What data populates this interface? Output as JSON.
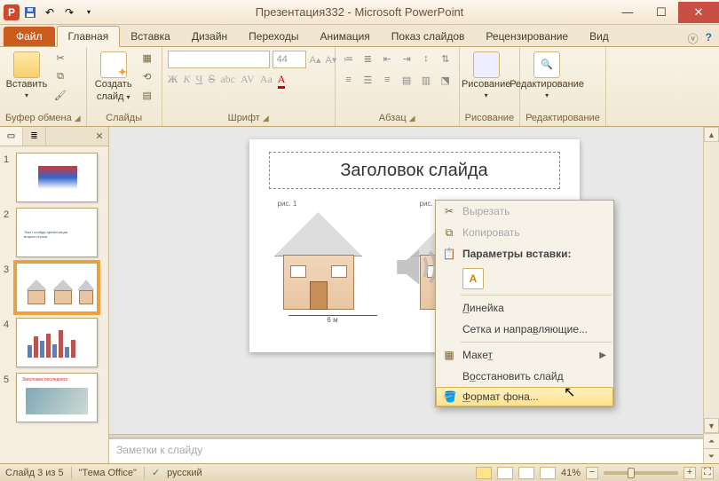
{
  "titlebar": {
    "title": "Презентация332 - Microsoft PowerPoint"
  },
  "qat": {
    "app_letter": "P"
  },
  "tabs": {
    "file": "Файл",
    "items": [
      "Главная",
      "Вставка",
      "Дизайн",
      "Переходы",
      "Анимация",
      "Показ слайдов",
      "Рецензирование",
      "Вид"
    ],
    "active_index": 0
  },
  "ribbon": {
    "clipboard": {
      "paste": "Вставить",
      "label": "Буфер обмена"
    },
    "slides": {
      "new_slide": "Создать",
      "new_slide2": "слайд",
      "label": "Слайды"
    },
    "font": {
      "size": "44",
      "label": "Шрифт"
    },
    "paragraph": {
      "label": "Абзац"
    },
    "drawing": {
      "btn": "Рисование",
      "label": "Рисование"
    },
    "editing": {
      "btn": "Редактирование",
      "label": "Редактирование"
    }
  },
  "thumbs": {
    "items": [
      {
        "num": "1"
      },
      {
        "num": "2"
      },
      {
        "num": "3"
      },
      {
        "num": "4"
      },
      {
        "num": "5"
      }
    ],
    "selected_index": 2
  },
  "slide": {
    "title": "Заголовок слайда",
    "pic1": "рис. 1",
    "pic2": "рис. 2",
    "dim": "6 м"
  },
  "context_menu": {
    "cut": "Вырезать",
    "copy": "Копировать",
    "paste_options": "Параметры вставки:",
    "paste_key": "A",
    "ruler": "Линейка",
    "grid": "Сетка и направляющие...",
    "layout": "Макет",
    "reset": "Восстановить слайд",
    "format_bg": "Формат фона..."
  },
  "notes": {
    "placeholder": "Заметки к слайду"
  },
  "status": {
    "slide_of": "Слайд 3 из 5",
    "theme": "\"Тема Office\"",
    "lang": "русский",
    "zoom": "41%"
  }
}
